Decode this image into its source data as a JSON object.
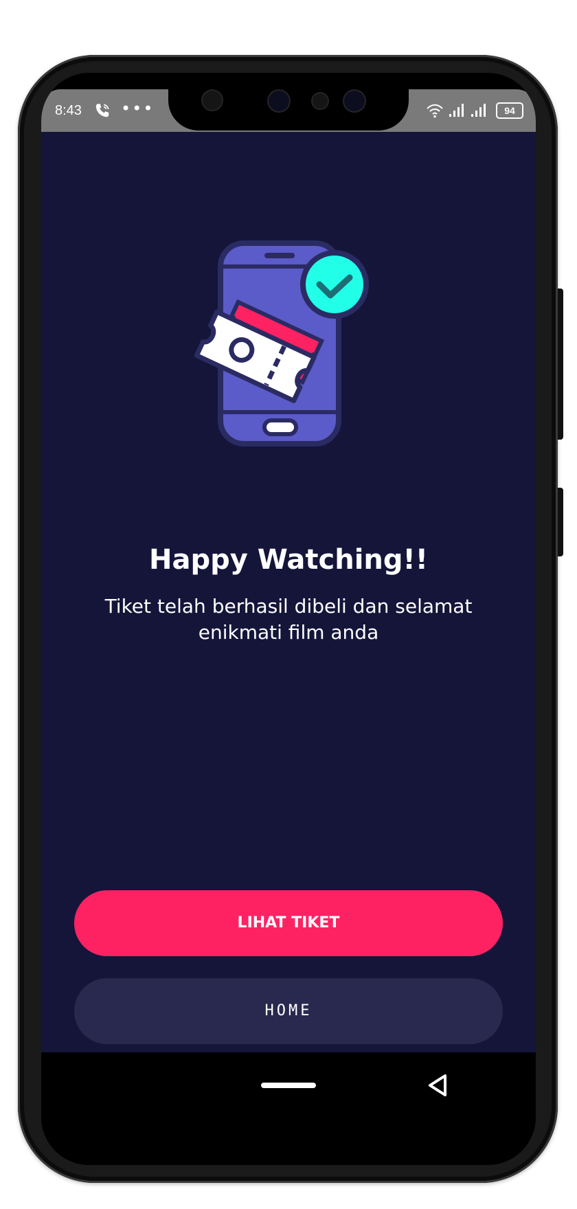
{
  "status_bar": {
    "time": "8:43",
    "more_indicator": "•••",
    "battery": "94",
    "icons": [
      "call-icon",
      "wifi-icon",
      "signal-icon",
      "signal-icon",
      "battery-icon"
    ]
  },
  "illustration": {
    "name": "phone-ticket-success-illustration",
    "colors": {
      "phone": "#5b5bc9",
      "outline": "#2b2b63",
      "check_badge": "#22ffe9",
      "ticket": "#ffffff",
      "ticket_back": "#ff2263"
    }
  },
  "main": {
    "title": "Happy Watching!!",
    "subtitle": "Tiket telah berhasil dibeli dan selamat enikmati film anda"
  },
  "buttons": {
    "primary_label": "LIHAT TIKET",
    "secondary_label": "HOME"
  },
  "colors": {
    "background": "#15153a",
    "accent": "#ff2263",
    "secondary_button": "#29294f"
  }
}
